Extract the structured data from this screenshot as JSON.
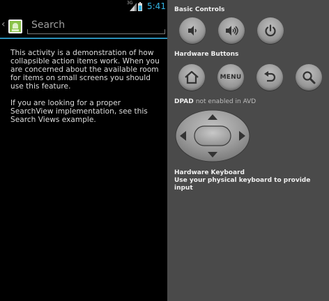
{
  "status_bar": {
    "network": "3G",
    "time": "5:41",
    "accent_color": "#33b5e5"
  },
  "action_bar": {
    "up_icon": "chevron-left-icon",
    "app_icon": "android-app-icon",
    "search": {
      "value": "",
      "placeholder": "Search"
    }
  },
  "content": {
    "paragraph_1": "This activity is a demonstration of how collapsible action items work. When you are concerned about the available room for items on small screens you should use this feature.",
    "paragraph_2": "If you are looking for a proper SearchView implementation, see this Search Views example."
  },
  "emulator": {
    "basic_controls": {
      "title": "Basic Controls",
      "buttons": [
        "volume-down-icon",
        "volume-up-icon",
        "power-icon"
      ]
    },
    "hardware_buttons": {
      "title": "Hardware Buttons",
      "buttons": [
        "home-icon",
        "menu-button",
        "back-icon",
        "search-icon"
      ],
      "menu_label": "MENU"
    },
    "dpad": {
      "title": "DPAD",
      "note": "not enabled in AVD"
    },
    "keyboard": {
      "title": "Hardware Keyboard",
      "note": "Use your physical keyboard to provide input"
    }
  }
}
